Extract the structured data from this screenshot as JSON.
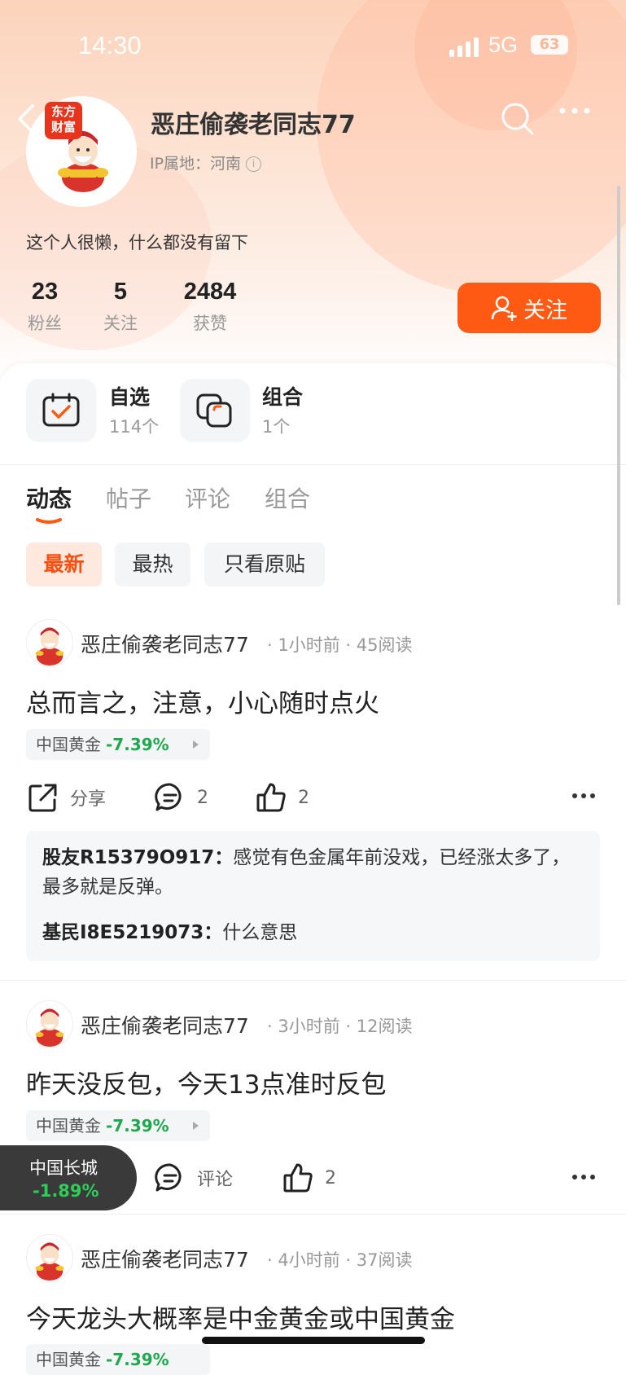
{
  "status_bar": {
    "time": "14:30",
    "network": "5G",
    "battery": "63"
  },
  "profile": {
    "logo_text_1": "东方",
    "logo_text_2": "财富",
    "name": "恶庄偷袭老同志77",
    "ip_location": "IP属地：河南",
    "bio": "这个人很懒，什么都没有留下",
    "stats": [
      {
        "value": "23",
        "label": "粉丝"
      },
      {
        "value": "5",
        "label": "关注"
      },
      {
        "value": "2484",
        "label": "获赞"
      }
    ],
    "follow_label": "关注"
  },
  "quick_links": [
    {
      "title": "自选",
      "sub": "114个"
    },
    {
      "title": "组合",
      "sub": "1个"
    }
  ],
  "tabs": [
    "动态",
    "帖子",
    "评论",
    "组合"
  ],
  "filters": [
    "最新",
    "最热",
    "只看原贴"
  ],
  "posts": [
    {
      "author": "恶庄偷袭老同志77",
      "meta": "· 1小时前 · 45阅读",
      "text": "总而言之，注意，小心随时点火",
      "stock": "中国黄金",
      "change": "-7.39%",
      "share_label": "分享",
      "comment_label": "2",
      "like_label": "2",
      "comments": [
        {
          "user": "股友R15379O917：",
          "text": "感觉有色金属年前没戏，已经涨太多了，最多就是反弹。"
        },
        {
          "user": "基民I8E5219073：",
          "text": "什么意思"
        }
      ]
    },
    {
      "author": "恶庄偷袭老同志77",
      "meta": "· 3小时前 · 12阅读",
      "text": "昨天没反包，今天13点准时反包",
      "stock": "中国黄金",
      "change": "-7.39%",
      "comment_label": "评论",
      "like_label": "2"
    },
    {
      "author": "恶庄偷袭老同志77",
      "meta": "· 4小时前 · 37阅读",
      "text": "今天龙头大概率是中金黄金或中国黄金",
      "stock": "中国黄金",
      "change": "-7.39%"
    }
  ],
  "floating_stock": {
    "name": "中国长城",
    "change": "-1.89%"
  },
  "colors": {
    "accent": "#ff5a14",
    "down": "#20a84e"
  }
}
